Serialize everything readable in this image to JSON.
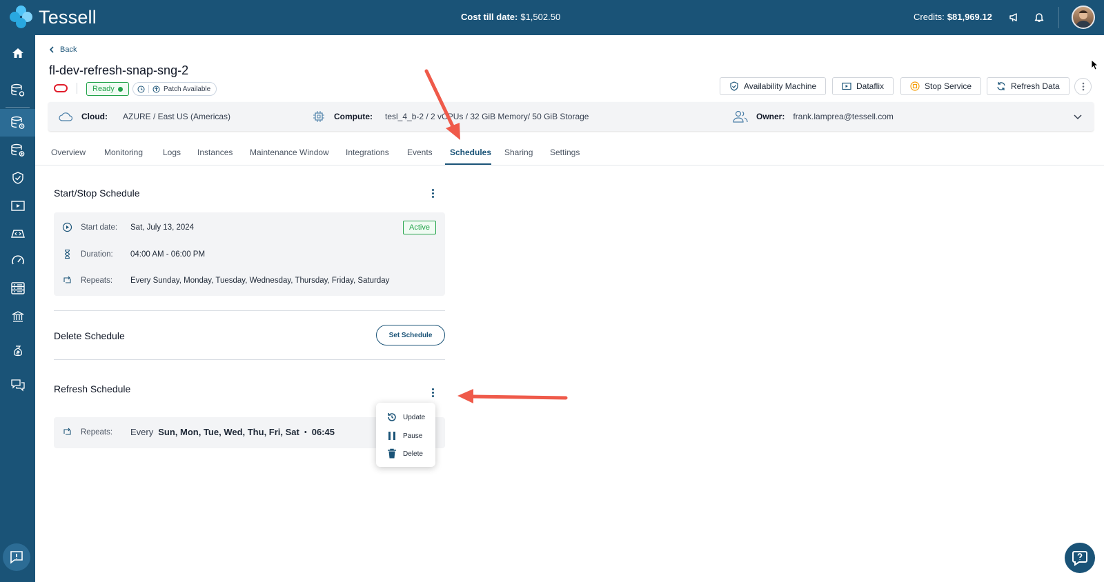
{
  "app": {
    "name": "Tessell"
  },
  "topbar": {
    "cost_label": "Cost till date:",
    "cost_value": "$1,502.50",
    "credits_label": "Credits:",
    "credits_value": "$81,969.12",
    "icons": [
      "megaphone-icon",
      "bell-icon"
    ]
  },
  "sidebar": {
    "items": [
      "home-icon",
      "database-settings-icon",
      "database-services-icon",
      "database-add-icon",
      "shield-check-icon",
      "dataflix-icon",
      "code-icon",
      "speedometer-icon",
      "server-icon",
      "bank-icon",
      "billing-icon",
      "chat-icon"
    ],
    "active_index": 2,
    "feedback_icon": "message-alert-icon"
  },
  "header": {
    "back_label": "Back",
    "title": "fl-dev-refresh-snap-sng-2",
    "status": "Ready",
    "patch": "Patch Available",
    "actions": {
      "availability": "Availability Machine",
      "dataflix": "Dataflix",
      "stop": "Stop Service",
      "refresh": "Refresh Data"
    }
  },
  "info_bar": {
    "cloud_label": "Cloud:",
    "cloud_value": "AZURE / East US (Americas)",
    "compute_label": "Compute:",
    "compute_value": "tesl_4_b-2 / 2 vCPUs / 32 GiB Memory/ 50 GiB Storage",
    "owner_label": "Owner:",
    "owner_value": "frank.lamprea@tessell.com"
  },
  "tabs": [
    {
      "label": "Overview"
    },
    {
      "label": "Monitoring"
    },
    {
      "label": "Logs"
    },
    {
      "label": "Instances"
    },
    {
      "label": "Maintenance Window"
    },
    {
      "label": "Integrations"
    },
    {
      "label": "Events"
    },
    {
      "label": "Schedules"
    },
    {
      "label": "Sharing"
    },
    {
      "label": "Settings"
    }
  ],
  "active_tab": "Schedules",
  "start_stop": {
    "title": "Start/Stop Schedule",
    "status": "Active",
    "start_label": "Start date:",
    "start_value": "Sat, July 13, 2024",
    "duration_label": "Duration:",
    "duration_value": "04:00 AM - 06:00 PM",
    "repeats_label": "Repeats:",
    "repeats_value": "Every Sunday, Monday, Tuesday, Wednesday, Thursday, Friday, Saturday"
  },
  "delete_schedule": {
    "title": "Delete Schedule",
    "button": "Set Schedule"
  },
  "refresh_schedule": {
    "title": "Refresh Schedule",
    "repeats_label": "Repeats:",
    "every": "Every",
    "days": "Sun, Mon, Tue, Wed, Thu, Fri, Sat",
    "dot": "•",
    "time": "06:45"
  },
  "menu": {
    "items": [
      {
        "label": "Update",
        "icon": "history-icon"
      },
      {
        "label": "Pause",
        "icon": "pause-icon"
      },
      {
        "label": "Delete",
        "icon": "trash-icon"
      }
    ]
  },
  "colors": {
    "brand": "#1a5377",
    "success": "#22a34a",
    "arrow": "#ef5a4a",
    "oracle": "#e11d2b"
  }
}
